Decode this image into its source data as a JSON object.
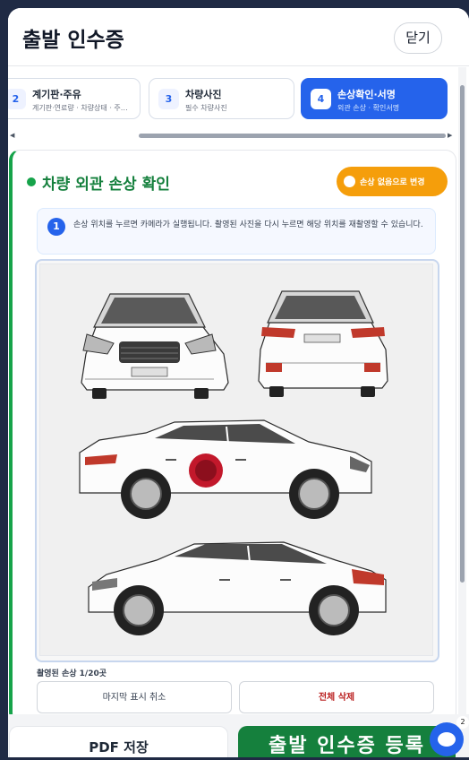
{
  "header": {
    "title": "출발 인수증",
    "close_label": "닫기"
  },
  "steps": [
    {
      "num": "2",
      "label": "계기판·주유",
      "sub": "계기판·연료량 · 차량상태 · 주…",
      "active": false
    },
    {
      "num": "3",
      "label": "차량사진",
      "sub": "필수 차량사진",
      "active": false
    },
    {
      "num": "4",
      "label": "손상확인·서명",
      "sub": "외관 손상 · 확인서명",
      "active": true
    }
  ],
  "section": {
    "title": "차량 외관 손상 확인",
    "no_damage_label": "손상 없음으로 변경",
    "info_num": "1",
    "info_text": "손상 위치를 누르면 카메라가 실행됩니다. 촬영된 사진을 다시 누르면 해당 위치를 재촬영할 수 있습니다.",
    "damage_count": "촬영된 손상 1/20곳",
    "undo_label": "마지막 표시 취소",
    "delete_all_label": "전체 삭제"
  },
  "footer": {
    "pdf_label": "PDF 저장",
    "register_label": "출발 인수증 등록"
  },
  "chat": {
    "badge": "2"
  },
  "colors": {
    "accent": "#2563eb",
    "green": "#15803d",
    "orange": "#f59e0b",
    "danger": "#b91c1c"
  }
}
